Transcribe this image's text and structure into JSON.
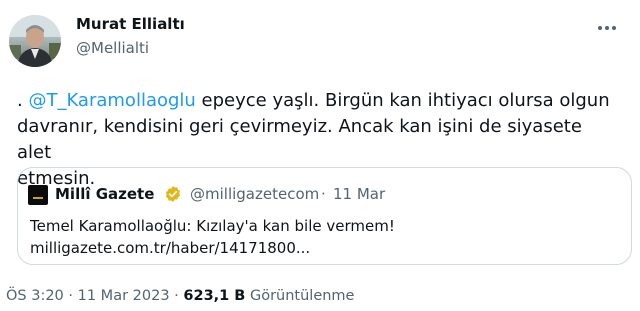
{
  "author": {
    "name": "Murat Ellialtı",
    "handle": "@Mellialti"
  },
  "tweet": {
    "prefix": ". ",
    "mention": "@T_Karamollaoglu",
    "line1_rest": " epeyce yaşlı. Birgün kan ihtiyacı olursa olgun",
    "line2": "davranır, kendisini geri çevirmeyiz. Ancak kan işini de siyasete alet",
    "line3": "etmesin."
  },
  "quote": {
    "name": "Millî Gazete",
    "handle": "@milligazetecom",
    "separator": "·",
    "date": "11 Mar",
    "text_line1": "Temel Karamollaoğlu: Kızılay'a kan bile vermem!",
    "text_line2": "milligazete.com.tr/haber/14171800..."
  },
  "meta": {
    "time": "ÖS 3:20",
    "sep1": " · ",
    "date": "11 Mar 2023",
    "sep2": " · ",
    "views": "623,1 B",
    "views_label": " Görüntülenme"
  },
  "colors": {
    "link": "#1d9bf0",
    "secondary_text": "#536471",
    "verified_gold": "#e2b719",
    "border": "#cfd9de"
  },
  "icons": {
    "more": "more-horizontal-icon",
    "verified": "verified-badge-icon",
    "avatar": "avatar-image",
    "quote_logo": "milli-gazete-logo"
  }
}
